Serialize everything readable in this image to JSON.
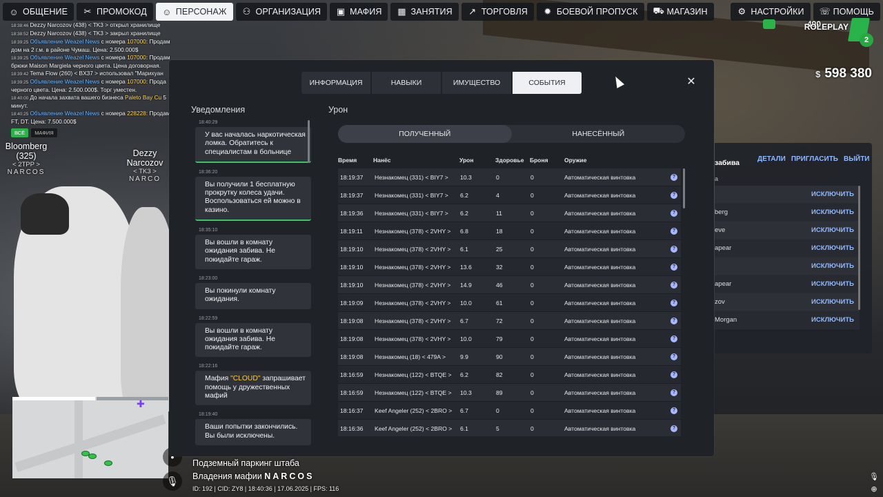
{
  "topnav": {
    "items": [
      {
        "label": "ОБЩЕНИЕ",
        "icon": "chat-icon"
      },
      {
        "label": "ПРОМОКОД",
        "icon": "gift-icon"
      },
      {
        "label": "ПЕРСОНАЖ",
        "icon": "user-icon",
        "active": true
      },
      {
        "label": "ОРГАНИЗАЦИЯ",
        "icon": "group-icon"
      },
      {
        "label": "МАФИЯ",
        "icon": "mask-icon"
      },
      {
        "label": "ЗАНЯТИЯ",
        "icon": "calendar-icon"
      },
      {
        "label": "ТОРГОВЛЯ",
        "icon": "chart-icon"
      },
      {
        "label": "БОЕВОЙ ПРОПУСК",
        "icon": "gear-icon"
      },
      {
        "label": "МАГАЗИН",
        "icon": "cart-icon"
      }
    ],
    "right": [
      {
        "label": "НАСТРОЙКИ",
        "icon": "settings-icon"
      },
      {
        "label": "ПОМОЩЬ",
        "icon": "help-icon"
      }
    ]
  },
  "chat": {
    "lines": [
      {
        "ts": "18:38:46",
        "text": "Dezzy Narcozov (438) < TK3 > открыл хранилище"
      },
      {
        "ts": "18:38:52",
        "text": "Dezzy Narcozov (438) < TK3 > закрыл хранилище"
      },
      {
        "ts": "18:39:25",
        "blue": "Объявление Weazel News",
        "mid": " с номера ",
        "yel": "107000",
        "text": ": Продам дом на 2 г.м. в районе Чумаш. Цена: 2.500.000$"
      },
      {
        "ts": "18:39:25",
        "blue": "Объявление Weazel News",
        "mid": " с номера ",
        "yel": "107000",
        "text": ": Продам брюки Maison Margiela черного цвета. Цена договорная."
      },
      {
        "ts": "18:39:42",
        "text": "Tema Flow (260) < BX37 > использовал \"Марихуан"
      },
      {
        "ts": "18:39:25",
        "blue": "Объявление Weazel News",
        "mid": " с номера ",
        "yel": "107000",
        "text": ": Прода черного цвета. Цена: 2.500.000$. Торг уместен."
      },
      {
        "ts": "18:40:00",
        "text": "До начала захвата вашего бизнеса ",
        "yel": "Paleto Bay Cu",
        "tail": " 5 минут."
      },
      {
        "ts": "18:40:25",
        "blue": "Объявление Weazel News",
        "mid": " с номера ",
        "yel": "228228",
        "text": ": Продам FT, DT. Цена: 7.500.000$"
      }
    ],
    "tabs": [
      "ВСЁ",
      "МАФИЯ"
    ]
  },
  "nametags": [
    {
      "name": "Bloomberg (325)",
      "tag": "< 2TPP >",
      "group": "NARCOS"
    },
    {
      "name": "Dezzy Narcozov",
      "tag": "< TK3 >",
      "group": "NARCO"
    }
  ],
  "hud": {
    "money_symbol": "$",
    "money": "598 380",
    "online": "490",
    "logo_text": "ROLEPLAY",
    "server_num": "2"
  },
  "org_panel": {
    "title": "забива",
    "links": [
      "ДЕТАЛИ",
      "ПРИГЛАСИТЬ",
      "ВЫЙТИ"
    ],
    "sub": "а",
    "rows": [
      "",
      "berg",
      "eve",
      "apear",
      "",
      "apear",
      "zov",
      "Morgan"
    ],
    "kick_label": "ИСКЛЮЧИТЬ"
  },
  "modal": {
    "tabs": [
      {
        "label": "ИНФОРМАЦИЯ"
      },
      {
        "label": "НАВЫКИ"
      },
      {
        "label": "ИМУЩЕСТВО"
      },
      {
        "label": "СОБЫТИЯ",
        "active": true
      }
    ],
    "close": "✕",
    "notifications_title": "Уведомления",
    "notifications": [
      {
        "time": "18:40:29",
        "text": "У вас началась наркотическая ломка. Обратитесь к специалистам в больнице",
        "green": true
      },
      {
        "time": "18:36:20",
        "text": "Вы получили 1 бесплатную прокрутку колеса удачи. Воспользоваться ей можно в казино.",
        "green": true
      },
      {
        "time": "18:35:10",
        "text": "Вы вошли в комнату ожидания забива. Не покидайте гараж."
      },
      {
        "time": "18:23:00",
        "text": "Вы покинули комнату ожидания."
      },
      {
        "time": "18:22:59",
        "text": "Вы вошли в комнату ожидания забива. Не покидайте гараж."
      },
      {
        "time": "18:22:16",
        "pre": "Мафия ",
        "hl": "\"CLOUD\"",
        "text": " запрашивает помощь у дружественных мафий"
      },
      {
        "time": "18:19:40",
        "text": "Ваши попытки закончились. Вы были исключены."
      }
    ],
    "damage_title": "Урон",
    "segments": [
      {
        "label": "ПОЛУЧЕННЫЙ",
        "active": true
      },
      {
        "label": "НАНЕСЁННЫЙ"
      }
    ],
    "table": {
      "headers": {
        "time": "Время",
        "who": "Нанёс",
        "dmg": "Урон",
        "hp": "Здоровье",
        "arm": "Броня",
        "wpn": "Оружие"
      },
      "rows": [
        {
          "time": "18:19:37",
          "who": "Незнакомец (331) < BIY7 >",
          "dmg": "10.3",
          "hp": "0",
          "arm": "0",
          "wpn": "Автоматическая винтовка"
        },
        {
          "time": "18:19:37",
          "who": "Незнакомец (331) < BIY7 >",
          "dmg": "6.2",
          "hp": "4",
          "arm": "0",
          "wpn": "Автоматическая винтовка"
        },
        {
          "time": "18:19:36",
          "who": "Незнакомец (331) < BIY7 >",
          "dmg": "6.2",
          "hp": "11",
          "arm": "0",
          "wpn": "Автоматическая винтовка"
        },
        {
          "time": "18:19:11",
          "who": "Незнакомец (378) < 2VHY >",
          "dmg": "6.8",
          "hp": "18",
          "arm": "0",
          "wpn": "Автоматическая винтовка"
        },
        {
          "time": "18:19:10",
          "who": "Незнакомец (378) < 2VHY >",
          "dmg": "6.1",
          "hp": "25",
          "arm": "0",
          "wpn": "Автоматическая винтовка"
        },
        {
          "time": "18:19:10",
          "who": "Незнакомец (378) < 2VHY >",
          "dmg": "13.6",
          "hp": "32",
          "arm": "0",
          "wpn": "Автоматическая винтовка"
        },
        {
          "time": "18:19:10",
          "who": "Незнакомец (378) < 2VHY >",
          "dmg": "14.9",
          "hp": "46",
          "arm": "0",
          "wpn": "Автоматическая винтовка"
        },
        {
          "time": "18:19:09",
          "who": "Незнакомец (378) < 2VHY >",
          "dmg": "10.0",
          "hp": "61",
          "arm": "0",
          "wpn": "Автоматическая винтовка"
        },
        {
          "time": "18:19:08",
          "who": "Незнакомец (378) < 2VHY >",
          "dmg": "6.7",
          "hp": "72",
          "arm": "0",
          "wpn": "Автоматическая винтовка"
        },
        {
          "time": "18:19:08",
          "who": "Незнакомец (378) < 2VHY >",
          "dmg": "10.0",
          "hp": "79",
          "arm": "0",
          "wpn": "Автоматическая винтовка"
        },
        {
          "time": "18:19:08",
          "who": "Незнакомец (18) < 479A >",
          "dmg": "9.9",
          "hp": "90",
          "arm": "0",
          "wpn": "Автоматическая винтовка"
        },
        {
          "time": "18:16:59",
          "who": "Незнакомец (122) < BTQE >",
          "dmg": "6.2",
          "hp": "82",
          "arm": "0",
          "wpn": "Автоматическая винтовка"
        },
        {
          "time": "18:16:59",
          "who": "Незнакомец (122) < BTQE >",
          "dmg": "10.3",
          "hp": "89",
          "arm": "0",
          "wpn": "Автоматическая винтовка"
        },
        {
          "time": "18:16:37",
          "who": "Keef Angeler (252) < 2BRO >",
          "dmg": "6.7",
          "hp": "0",
          "arm": "0",
          "wpn": "Автоматическая винтовка"
        },
        {
          "time": "18:16:36",
          "who": "Keef Angeler (252) < 2BRO >",
          "dmg": "6.1",
          "hp": "5",
          "arm": "0",
          "wpn": "Автоматическая винтовка"
        }
      ]
    }
  },
  "location": {
    "place": "Подземный паркинг штаба",
    "prefix": "Владения мафии",
    "mafia": "NARCOS",
    "info": "ID: 192 | CID: ZY8 | 18:40:36 | 17.06.2025 | FPS: 116"
  }
}
